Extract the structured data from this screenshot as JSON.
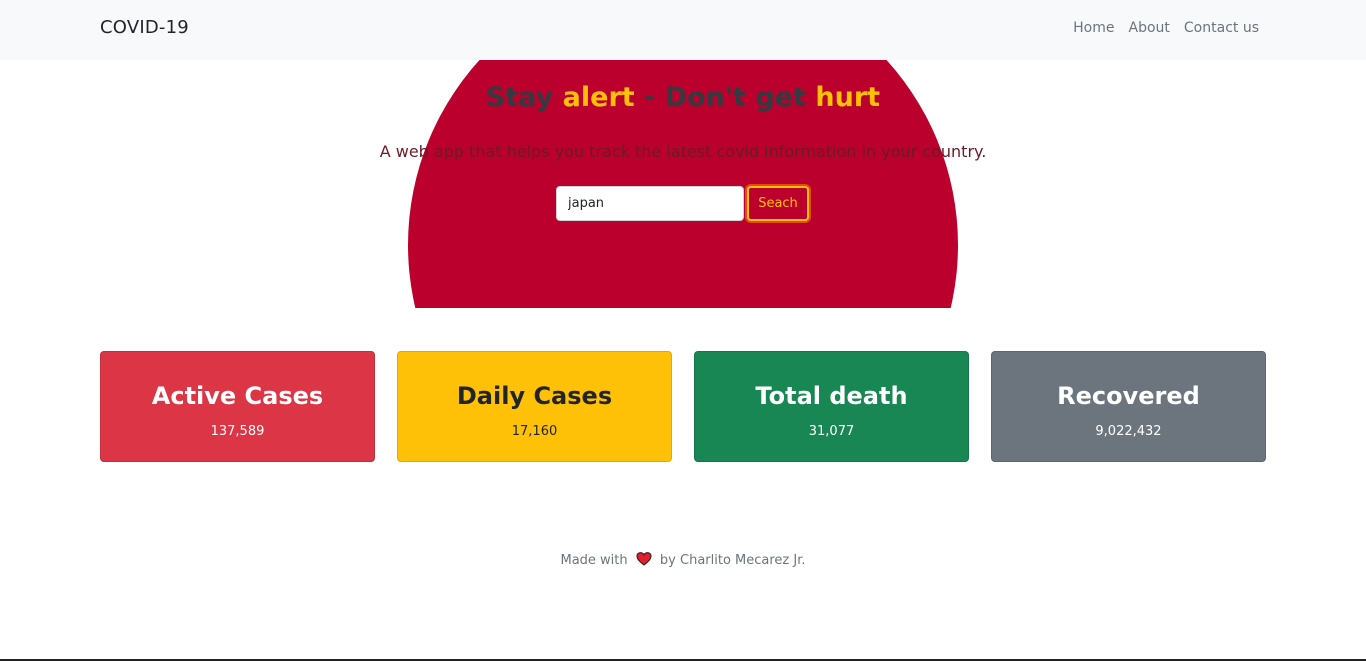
{
  "navbar": {
    "brand": "COVID-19",
    "links": [
      "Home",
      "About",
      "Contact us"
    ]
  },
  "hero": {
    "title_parts": [
      "Stay ",
      "alert",
      " - Don't get ",
      "hurt"
    ],
    "subtitle": "A web app that helps you track the latest covid information in your country.",
    "search": {
      "value": "japan",
      "button_label": "Seach"
    }
  },
  "cards": [
    {
      "title": "Active Cases",
      "value": "137,589",
      "color": "#dc3545"
    },
    {
      "title": "Daily Cases",
      "value": "17,160",
      "color": "#ffc107"
    },
    {
      "title": "Total death",
      "value": "31,077",
      "color": "#198754"
    },
    {
      "title": "Recovered",
      "value": "9,022,432",
      "color": "#6c757d"
    }
  ],
  "footer": {
    "prefix": "Made with",
    "heart_icon": "heart-icon",
    "suffix": "by Charlito Mecarez Jr."
  },
  "colors": {
    "flag_red": "#bc002d",
    "accent_yellow": "#ffc107"
  }
}
